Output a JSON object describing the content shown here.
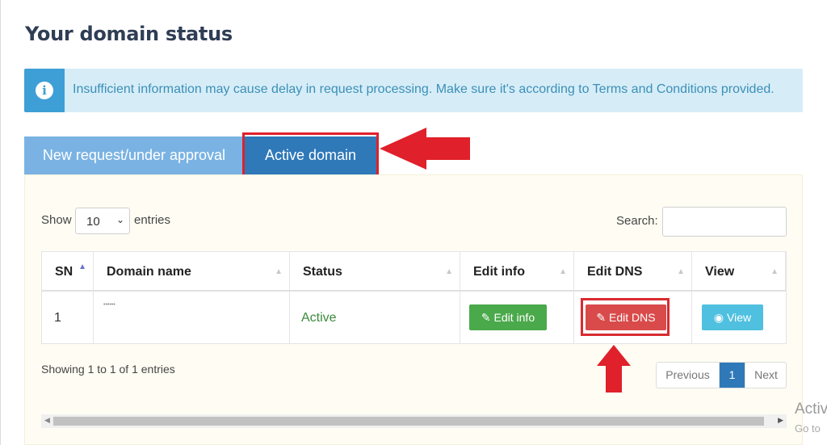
{
  "page_title": "Your domain status",
  "alert": {
    "icon": "info-circle-icon",
    "text": "Insufficient information may cause delay in request processing. Make sure it's according to Terms and Conditions provided."
  },
  "tabs": [
    {
      "label": "New request/under approval",
      "active": false
    },
    {
      "label": "Active domain",
      "active": true
    }
  ],
  "table_controls": {
    "show_label": "Show",
    "length_value": "10",
    "entries_label": "entries",
    "search_label": "Search:",
    "search_value": ""
  },
  "table": {
    "columns": [
      "SN",
      "Domain name",
      "Status",
      "Edit info",
      "Edit DNS",
      "View"
    ],
    "rows": [
      {
        "sn": "1",
        "domain_name": "••••••",
        "status": "Active",
        "edit_info_label": "Edit info",
        "edit_dns_label": "Edit DNS",
        "view_label": "View"
      }
    ]
  },
  "footer": {
    "showing_text": "Showing 1 to 1 of 1 entries",
    "pagination": {
      "previous": "Previous",
      "current": "1",
      "next": "Next"
    }
  },
  "watermark": {
    "line1": "Activ",
    "line2": "Go to"
  },
  "colors": {
    "tab_active": "#2f79b9",
    "tab_inactive": "#7ab3e3",
    "alert_bg": "#d6edf7",
    "btn_edit_info": "#4aa94a",
    "btn_edit_dns": "#d94b4b",
    "btn_view": "#4fc0df",
    "annotation_red": "#e0202a"
  }
}
